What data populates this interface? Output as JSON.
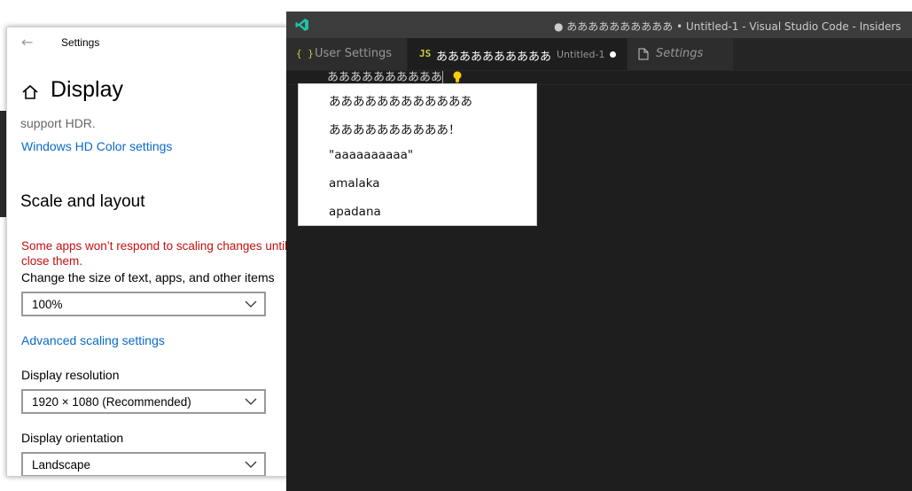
{
  "settings": {
    "window_title": "Settings",
    "page_title": "Display",
    "hdr_text": "support HDR.",
    "hd_color_link": "Windows HD Color settings",
    "scale_section": "Scale and layout",
    "scale_warning": "Some apps won’t respond to scaling changes until you close them.",
    "size_label": "Change the size of text, apps, and other items",
    "size_value": "100%",
    "advanced_link": "Advanced scaling settings",
    "resolution_label": "Display resolution",
    "resolution_value": "1920 × 1080 (Recommended)",
    "orientation_label": "Display orientation",
    "orientation_value": "Landscape"
  },
  "vscode": {
    "window_title": "● ああああああああああ • Untitled-1 - Visual Studio Code - Insiders",
    "tabs": [
      {
        "icon": "{ }",
        "label": "User Settings",
        "description": ""
      },
      {
        "icon": "JS",
        "label": "ああああああああああ",
        "description": "Untitled-1"
      },
      {
        "icon": "file-icon",
        "label": "Settings",
        "description": ""
      }
    ],
    "editor_line": "ああああああああああ",
    "suggestions": [
      "ああああああああああああ",
      "ああああああああああ！",
      "\"aaaaaaaaaa\"",
      "amalaka",
      "apadana"
    ]
  },
  "colors": {
    "link": "#0a6ac9",
    "warning": "#c50f0f",
    "vscode_bg": "#1e1e1e",
    "vscode_title": "#3c3c3c",
    "vscode_logo": "#24bfa5",
    "js_icon": "#cbcb41"
  }
}
